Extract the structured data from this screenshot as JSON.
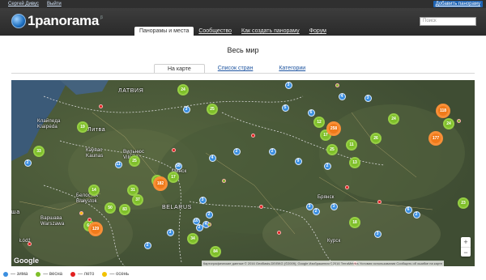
{
  "topbar": {
    "user_name": "Сергей Дивус",
    "logout": "Выйти",
    "add_panorama": "Добавить панораму"
  },
  "header": {
    "logo_text": "1panorama",
    "logo_sup": "β",
    "search_placeholder": "Поиск"
  },
  "nav": [
    {
      "label": "Панорамы и места",
      "active": true
    },
    {
      "label": "Сообщество",
      "active": false
    },
    {
      "label": "Как создать панораму",
      "active": false
    },
    {
      "label": "Форум",
      "active": false
    }
  ],
  "page_title": "Весь мир",
  "tabs": [
    {
      "label": "На карте",
      "active": true
    },
    {
      "label": "Список стран",
      "active": false
    },
    {
      "label": "Категории",
      "active": false
    }
  ],
  "map": {
    "labels": {
      "latvia": "ЛАТВИЯ",
      "lithuania": "Литва",
      "belarus": "BELARUS",
      "klaipeda": "Клайпеда Klaipėda",
      "kaunas": "Каунас Kaunas",
      "vilnius": "Вильнюс Vilnius",
      "bialystok": "Белосток Białystok",
      "warsaw": "Варшава Warszawa",
      "lodz": "Łódź",
      "minsk": "Минск",
      "bryansk": "Брянск",
      "kursk": "Курск",
      "sha": "ша"
    },
    "clusters": [
      {
        "v": "24",
        "c": "green"
      },
      {
        "v": "3",
        "c": "blue"
      },
      {
        "v": "25",
        "c": "green"
      },
      {
        "v": "19",
        "c": "green"
      },
      {
        "v": "33",
        "c": "green"
      },
      {
        "v": "2",
        "c": "blue"
      },
      {
        "v": "25",
        "c": "green"
      },
      {
        "v": "11",
        "c": "blue"
      },
      {
        "v": "58",
        "c": "blue"
      },
      {
        "v": "24",
        "c": "green"
      },
      {
        "v": "182",
        "c": "orange"
      },
      {
        "v": "17",
        "c": "green"
      },
      {
        "v": "31",
        "c": "green"
      },
      {
        "v": "14",
        "c": "green"
      },
      {
        "v": "37",
        "c": "green"
      },
      {
        "v": "50",
        "c": "green"
      },
      {
        "v": "83",
        "c": "green"
      },
      {
        "v": "64",
        "c": "green"
      },
      {
        "v": "129",
        "c": "orange"
      },
      {
        "v": "34",
        "c": "green"
      },
      {
        "v": "84",
        "c": "green"
      },
      {
        "v": "12",
        "c": "green"
      },
      {
        "v": "17",
        "c": "green"
      },
      {
        "v": "258",
        "c": "orange"
      },
      {
        "v": "25",
        "c": "green"
      },
      {
        "v": "13",
        "c": "green"
      },
      {
        "v": "11",
        "c": "green"
      },
      {
        "v": "26",
        "c": "green"
      },
      {
        "v": "24",
        "c": "green"
      },
      {
        "v": "118",
        "c": "orange"
      },
      {
        "v": "177",
        "c": "orange"
      },
      {
        "v": "24",
        "c": "green"
      },
      {
        "v": "23",
        "c": "green"
      },
      {
        "v": "18",
        "c": "green"
      },
      {
        "v": "3",
        "c": "blue"
      },
      {
        "v": "5",
        "c": "blue"
      },
      {
        "v": "6",
        "c": "blue"
      },
      {
        "v": "4",
        "c": "blue"
      },
      {
        "v": "3",
        "c": "blue"
      },
      {
        "v": "2",
        "c": "blue"
      },
      {
        "v": "9",
        "c": "blue"
      },
      {
        "v": "2",
        "c": "blue"
      },
      {
        "v": "3",
        "c": "blue"
      },
      {
        "v": "2",
        "c": "blue"
      },
      {
        "v": "10",
        "c": "blue"
      },
      {
        "v": "4",
        "c": "blue"
      },
      {
        "v": "3",
        "c": "blue"
      },
      {
        "v": "2",
        "c": "blue"
      },
      {
        "v": "2",
        "c": "blue"
      },
      {
        "v": "3",
        "c": "blue"
      },
      {
        "v": "2",
        "c": "blue"
      },
      {
        "v": "3",
        "c": "blue"
      },
      {
        "v": "6",
        "c": "blue"
      },
      {
        "v": "2",
        "c": "blue"
      },
      {
        "v": "4",
        "c": "blue"
      },
      {
        "v": "2",
        "c": "blue"
      },
      {
        "v": "3",
        "c": "blue"
      }
    ],
    "google": "Google",
    "attribution": "Картографические данные © 2016 GeoBasis-DE/BKG (©2009), Google Изображения ©2016 TerraMetrics   Условия использования   Сообщить об ошибке на карте",
    "zoom_in": "+",
    "zoom_out": "−"
  },
  "legend": [
    {
      "label": "— зима",
      "color": "#3b8fe0"
    },
    {
      "label": "— весна",
      "color": "#7fbf2a"
    },
    {
      "label": "— лето",
      "color": "#e22020"
    },
    {
      "label": "— осень",
      "color": "#f2c200"
    }
  ]
}
